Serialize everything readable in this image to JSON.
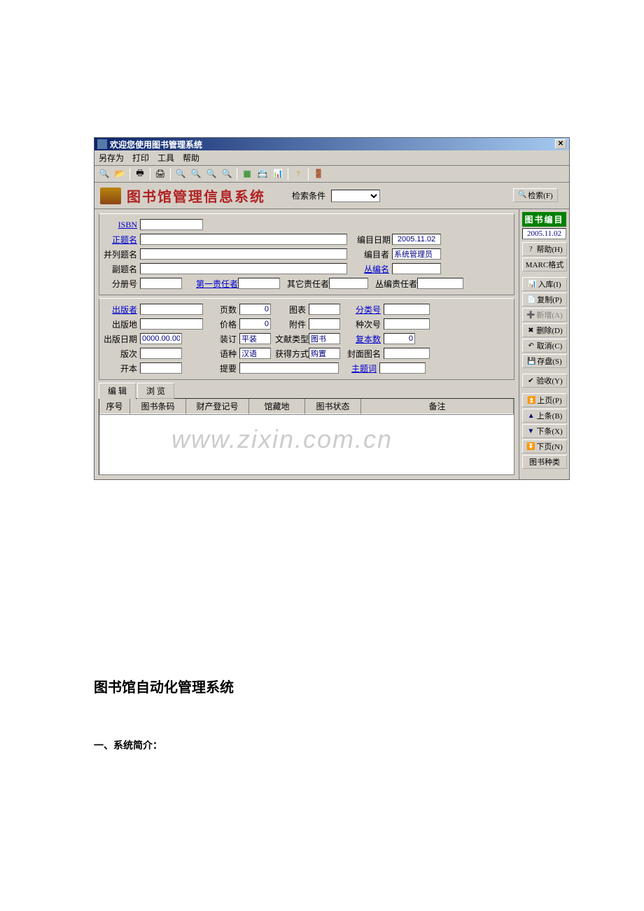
{
  "window": {
    "title": "欢迎您使用图书管理系统"
  },
  "menubar": [
    "另存为",
    "打印",
    "工具",
    "帮助"
  ],
  "header": {
    "title": "图书馆管理信息系统",
    "search_label": "检索条件"
  },
  "side": {
    "section_badge": "图书编目",
    "date": "2005.11.02",
    "buttons": {
      "search": "检索(F)",
      "help": "帮助(H)",
      "marc": "MARC格式",
      "ruku": "入库(I)",
      "copy": "复制(P)",
      "add": "新增(A)",
      "delete": "删除(D)",
      "cancel": "取消(C)",
      "save": "存盘(S)",
      "accept": "验收(Y)",
      "pgup": "上页(P)",
      "prev": "上条(B)",
      "next": "下条(X)",
      "pgdn": "下页(N)",
      "kinds": "图书种类"
    }
  },
  "form": {
    "labels": {
      "isbn": "ISBN",
      "title": "正题名",
      "parallel": "并列题名",
      "subtitle": "副题名",
      "volume": "分册号",
      "first_author": "第一责任者",
      "other_author": "其它责任者",
      "catalog_date": "编目日期",
      "cataloger": "编目者",
      "series": "丛编名",
      "series_author": "丛编责任者",
      "publisher": "出版者",
      "pub_place": "出版地",
      "pub_date": "出版日期",
      "edition": "版次",
      "format": "开本",
      "pages": "页数",
      "price": "价格",
      "binding": "装订",
      "language": "语种",
      "summary": "提要",
      "charts": "图表",
      "attachment": "附件",
      "doc_type": "文献类型",
      "acq_method": "获得方式",
      "class_no": "分类号",
      "species_no": "种次号",
      "copies": "复本数",
      "cover_name": "封面图名",
      "subject": "主题词"
    },
    "values": {
      "catalog_date": "2005.11.02",
      "cataloger": "系统管理员",
      "pub_date": "0000.00.00",
      "pages": "0",
      "price": "0",
      "binding": "平装",
      "language": "汉语",
      "doc_type": "图书",
      "acq_method": "购置",
      "copies": "0"
    }
  },
  "tabs": {
    "edit": "编 辑",
    "browse": "浏 览"
  },
  "grid_cols": [
    "序号",
    "图书条码",
    "财产登记号",
    "馆藏地",
    "图书状态",
    "备注"
  ],
  "watermark": "www.zixin.com.cn",
  "doc": {
    "h1": "图书馆自动化管理系统",
    "h2": "一、系统简介："
  }
}
